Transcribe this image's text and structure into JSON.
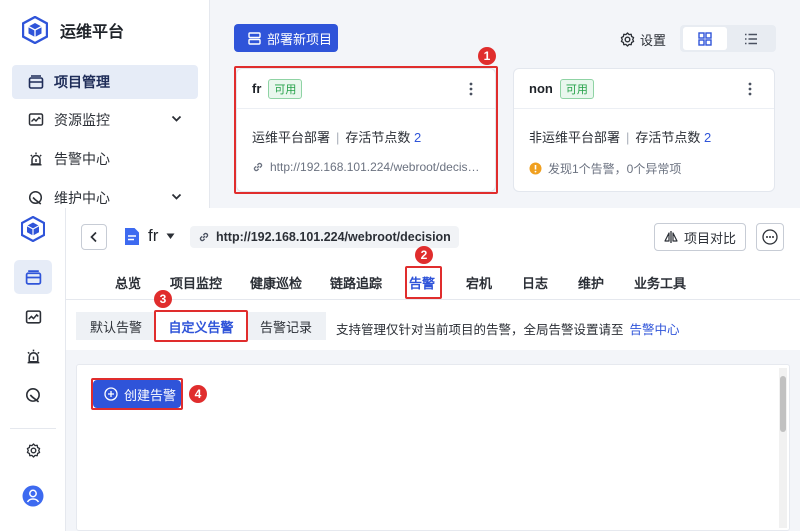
{
  "top": {
    "brand": {
      "title": "运维平台"
    },
    "nav": [
      {
        "label": "项目管理",
        "active": true,
        "icon": "project-icon"
      },
      {
        "label": "资源监控",
        "icon": "monitor-icon",
        "expandable": true
      },
      {
        "label": "告警中心",
        "icon": "alarm-icon"
      },
      {
        "label": "维护中心",
        "icon": "maintenance-icon",
        "expandable": true
      }
    ],
    "deploy_button": "部署新项目",
    "settings_label": "设置",
    "view_mode": "grid",
    "cards": [
      {
        "name": "fr",
        "status": "可用",
        "desc": "运维平台部署",
        "nodes_label": "存活节点数",
        "nodes": "2",
        "url": "http://192.168.101.224/webroot/decis…",
        "highlighted": true
      },
      {
        "name": "non",
        "status": "可用",
        "desc": "非运维平台部署",
        "nodes_label": "存活节点数",
        "nodes": "2",
        "warning": "发现1个告警，0个异常项"
      }
    ]
  },
  "bottom": {
    "project_name": "fr",
    "url": "http://192.168.101.224/webroot/decision",
    "compare_button": "项目对比",
    "tabs": [
      "总览",
      "项目监控",
      "健康巡检",
      "链路追踪",
      "告警",
      "宕机",
      "日志",
      "维护",
      "业务工具"
    ],
    "active_tab": "告警",
    "subtabs": [
      "默认告警",
      "自定义告警",
      "告警记录"
    ],
    "active_subtab": "自定义告警",
    "note": "支持管理仅针对当前项目的告警，全局告警设置请至",
    "note_link": "告警中心",
    "create_button": "创建告警"
  },
  "annotations": [
    "1",
    "2",
    "3",
    "4"
  ],
  "colors": {
    "accent": "#2f54d9",
    "highlight": "#e02d2d",
    "success": "#24a148",
    "warning": "#f0a020"
  }
}
